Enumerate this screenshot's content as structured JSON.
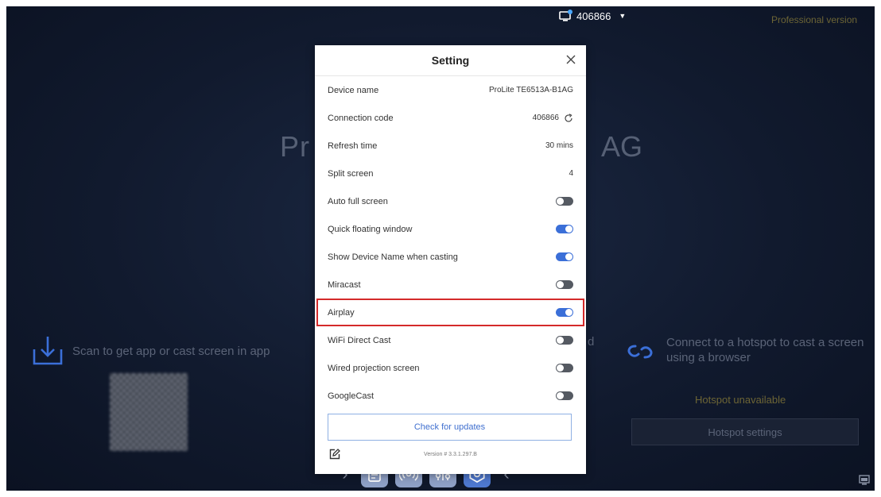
{
  "header": {
    "connection_code": "406866",
    "edition": "Professional version"
  },
  "background": {
    "device_title_left": "Pr",
    "device_title_right": "AG",
    "scan_text": "Scan to get app or cast screen in app",
    "fragment": "d",
    "hotspot_text": "Connect to a hotspot to cast a screen using a browser",
    "hotspot_status": "Hotspot unavailable",
    "hotspot_button": "Hotspot settings"
  },
  "settings": {
    "title": "Setting",
    "device_name": {
      "label": "Device name",
      "value": "ProLite TE6513A-B1AG"
    },
    "connection_code": {
      "label": "Connection code",
      "value": "406866"
    },
    "refresh_time": {
      "label": "Refresh time",
      "value": "30 mins"
    },
    "split_screen": {
      "label": "Split screen",
      "value": "4"
    },
    "toggles": [
      {
        "label": "Auto full screen",
        "on": false
      },
      {
        "label": "Quick floating window",
        "on": true
      },
      {
        "label": "Show Device Name when casting",
        "on": true
      },
      {
        "label": "Miracast",
        "on": false
      },
      {
        "label": "Airplay",
        "on": true
      },
      {
        "label": "WiFi Direct Cast",
        "on": false
      },
      {
        "label": "Wired projection screen",
        "on": false
      },
      {
        "label": "GoogleCast",
        "on": false
      }
    ],
    "update_button": "Check for updates",
    "version": "Version # 3.3.1.297.B"
  },
  "colors": {
    "toggle_on": "#3b6fd8",
    "toggle_off": "#555a62",
    "highlight": "#d42a2a",
    "accent": "#3f6fcf"
  }
}
